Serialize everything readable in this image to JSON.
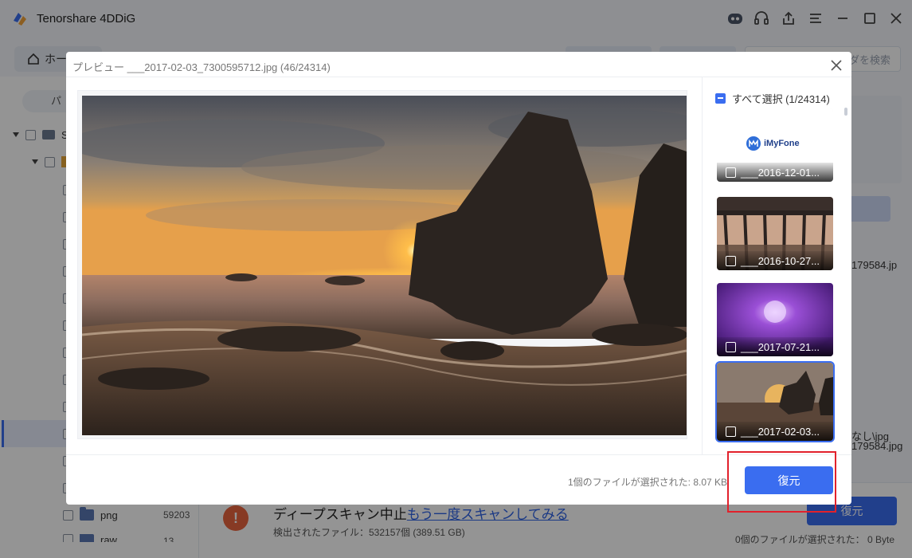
{
  "app": {
    "title": "Tenorshare 4DDiG",
    "home_tab": "ホー",
    "search_placeholder": "ダを検索"
  },
  "sidebar": {
    "tab_label": "パ",
    "tree": [
      {
        "level": 0,
        "label": "S"
      },
      {
        "level": 1,
        "label": ""
      },
      {
        "name": "png",
        "count": "59203"
      },
      {
        "name": "raw",
        "count": "13"
      }
    ]
  },
  "background_right": {
    "file_fragment": "179584.jp",
    "file_fragment_2": "なし\\jpg",
    "file_fragment_3": "179584.jpg"
  },
  "bottom": {
    "scan_status": "ディープスキャン中止",
    "scan_link": "もう一度スキャンしてみる",
    "found_files": "検出されたファイル：532157個 (389.51 GB)",
    "recover_label": "復元",
    "selected_info": "0個のファイルが選択された： 0 Byte",
    "warn_glyph": "!"
  },
  "preview": {
    "title": "プレビュー ___2017-02-03_7300595712.jpg (46/24314)",
    "select_all": "すべて選択 (1/24314)",
    "thumbnails": [
      {
        "caption": "___2016-12-01...",
        "logo": "iMyFone",
        "active": false
      },
      {
        "caption": "___2016-10-27...",
        "active": false
      },
      {
        "caption": "___2017-07-21...",
        "active": false
      },
      {
        "caption": "___2017-02-03...",
        "active": true
      }
    ],
    "footer_info": "1個のファイルが選択された:   8.07 KB",
    "recover_label": "復元"
  },
  "colors": {
    "accent": "#3a6df0",
    "highlight_box": "#e2212b",
    "warning": "#e8643f"
  }
}
